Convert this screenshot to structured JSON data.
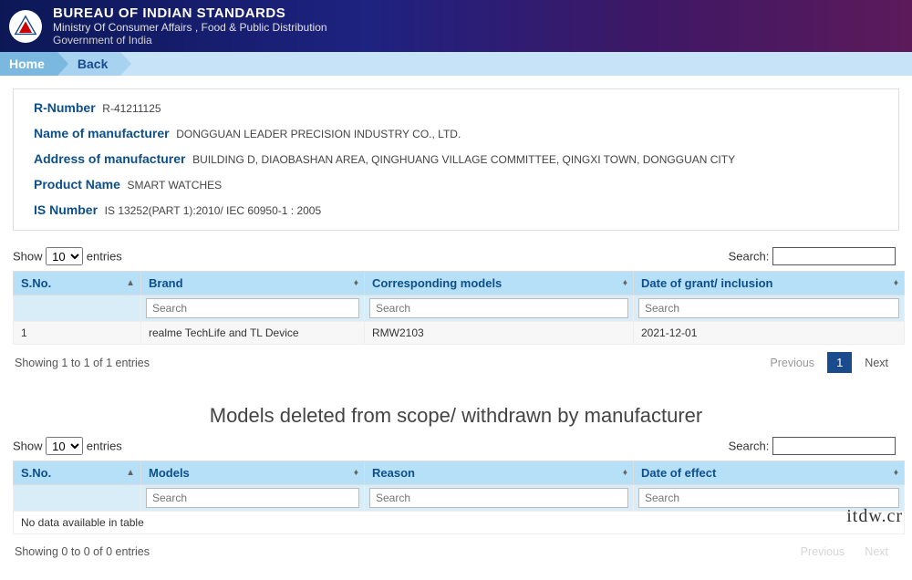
{
  "header": {
    "org_name": "BUREAU OF INDIAN STANDARDS",
    "ministry": "Ministry Of Consumer Affairs , Food & Public Distribution",
    "gov": "Government of India"
  },
  "breadcrumb": {
    "home": "Home",
    "back": "Back"
  },
  "details": {
    "r_number_label": "R-Number",
    "r_number": "R-41211125",
    "manufacturer_label": "Name of manufacturer",
    "manufacturer": "DONGGUAN LEADER PRECISION INDUSTRY CO., LTD.",
    "address_label": "Address of manufacturer",
    "address": "BUILDING D, DIAOBASHAN AREA, QINGHUANG VILLAGE COMMITTEE, QINGXI TOWN, DONGGUAN CITY",
    "product_label": "Product Name",
    "product": "SMART WATCHES",
    "is_label": "IS Number",
    "is_number": "IS 13252(PART 1):2010/ IEC 60950-1 : 2005"
  },
  "common": {
    "show": "Show",
    "entries": "entries",
    "search_label": "Search:",
    "search_placeholder": "Search",
    "show_value": "10",
    "previous": "Previous",
    "next": "Next",
    "page1": "1",
    "nodata": "No data available in table"
  },
  "table1": {
    "columns": {
      "sno": "S.No.",
      "brand": "Brand",
      "models": "Corresponding models",
      "date": "Date of grant/ inclusion"
    },
    "rows": [
      {
        "sno": "1",
        "brand": "realme TechLife and TL Device",
        "models": "RMW2103",
        "date": "2021-12-01"
      }
    ],
    "info": "Showing 1 to 1 of 1 entries"
  },
  "section2_title": "Models deleted from scope/ withdrawn by manufacturer",
  "table2": {
    "columns": {
      "sno": "S.No.",
      "models": "Models",
      "reason": "Reason",
      "date": "Date of effect"
    },
    "info": "Showing 0 to 0 of 0 entries"
  },
  "watermark": "itdw.cr"
}
